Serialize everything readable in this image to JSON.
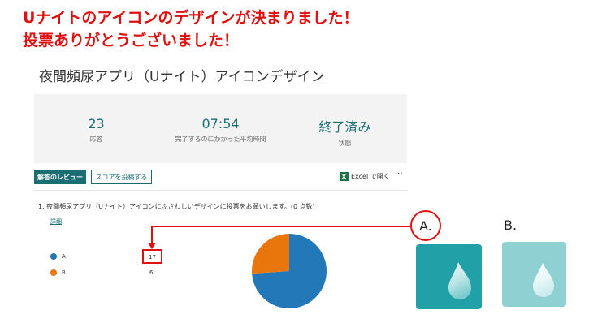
{
  "headline": {
    "line1": "Uナイトのアイコンのデザインが決まりました！",
    "line2": "投票ありがとうございました！"
  },
  "form": {
    "title": "夜間頻尿アプリ（Uナイト）アイコンデザイン"
  },
  "stats": {
    "responses": {
      "value": "23",
      "label": "応答"
    },
    "avg_time": {
      "value": "07:54",
      "label": "完了するのにかかった平均時間"
    },
    "status": {
      "value": "終了済み",
      "label": "状態"
    }
  },
  "toolbar": {
    "review_label": "解答のレビュー",
    "post_score_label": "スコアを投稿する",
    "excel_label": "Excel で開く",
    "excel_icon_text": "X",
    "more_label": "···"
  },
  "question": {
    "text": "1. 夜間頻尿アプリ（Uナイト）アイコンにふさわしいデザインに投票をお願いします。(0 点数)",
    "detail_link": "詳細",
    "options": [
      {
        "name": "A",
        "count": "17",
        "color": "#1f77b4"
      },
      {
        "name": "B",
        "count": "6",
        "color": "#e8760c"
      }
    ]
  },
  "chart_data": {
    "type": "pie",
    "categories": [
      "A",
      "B"
    ],
    "values": [
      17,
      6
    ],
    "colors": [
      "#2378b8",
      "#e8760c"
    ]
  },
  "annotations": {
    "label_a": "A.",
    "label_b": "B.",
    "accent_color": "#e01010"
  },
  "icons": {
    "a_name": "unite-icon-design-a",
    "a_bg": "#21a0a7",
    "b_name": "unite-icon-design-b",
    "b_bg": "#8fd0d3"
  }
}
